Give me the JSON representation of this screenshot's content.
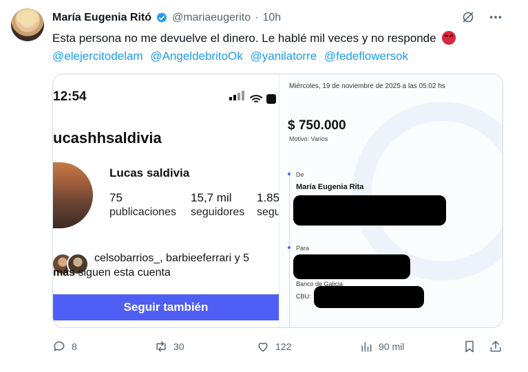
{
  "author": {
    "name": "María Eugenia Ritó",
    "handle": "@mariaeugerito",
    "separator": "·",
    "time": "10h"
  },
  "tweet": {
    "text": "Esta persona no me devuelve el dinero. Le hablé mil veces y no responde",
    "mentions": [
      "@elejercitodelam",
      "@AngeldebritoOk",
      "@yanilatorre",
      "@fedeflowersok"
    ]
  },
  "instagram": {
    "clock": "12:54",
    "username": "ucashhsaldivia",
    "full_name": "Lucas saldivia",
    "stats": [
      {
        "value": "75",
        "label": "publicaciones"
      },
      {
        "value": "15,7 mil",
        "label": "seguidores"
      },
      {
        "value": "1.85",
        "label": "segu"
      }
    ],
    "followed_by_line1": "celsobarrios_, barbieeferrari y 5",
    "followed_by_line2_bold": "más",
    "followed_by_line2": "siguen esta cuenta",
    "follow_button": "Seguir también"
  },
  "receipt": {
    "date": "Miércoles, 19 de noviembre de 2025 a las 05:02 hs",
    "amount": "$ 750.000",
    "motivo": "Motivo: Varios",
    "from_label": "De",
    "from_name": "María Eugenia Rita",
    "to_label": "Para",
    "bank": "Banco de Galicia",
    "cbu_label": "CBU:"
  },
  "actions": {
    "replies": "8",
    "retweets": "30",
    "likes": "122",
    "views": "90 mil"
  },
  "colors": {
    "link": "#1d9bf0",
    "muted": "#536471",
    "instagram_button": "#4f5ff5",
    "verified": "#1d9bf0"
  }
}
